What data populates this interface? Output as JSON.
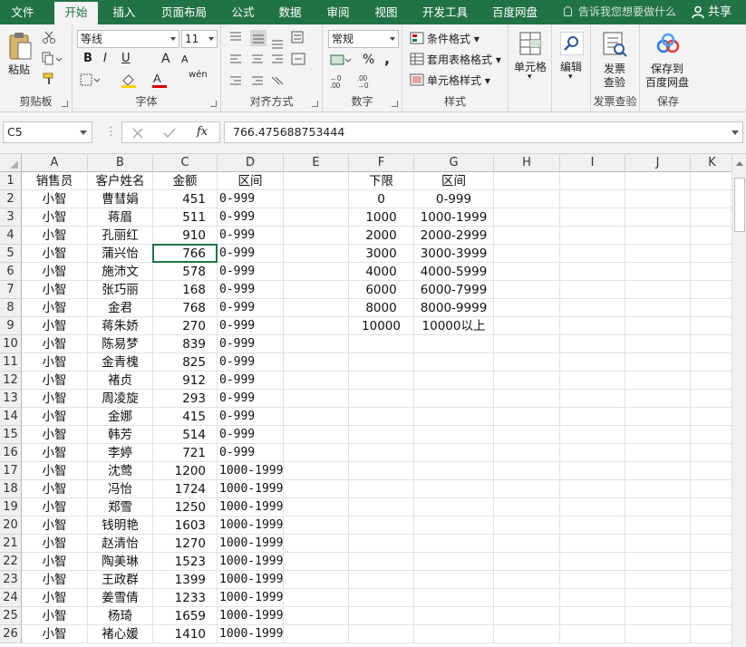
{
  "tabs": [
    "文件",
    "开始",
    "插入",
    "页面布局",
    "公式",
    "数据",
    "审阅",
    "视图",
    "开发工具",
    "百度网盘"
  ],
  "tell_me": "告诉我您想要做什么",
  "share": "共享",
  "ribbon": {
    "clipboard": {
      "paste": "粘贴",
      "label": "剪贴板"
    },
    "font": {
      "name": "等线",
      "size": "11",
      "label": "字体",
      "bold": "B",
      "italic": "I",
      "underline": "U",
      "wen": "wén",
      "grow": "A",
      "shrink": "A"
    },
    "alignment": {
      "label": "对齐方式"
    },
    "number": {
      "format": "常规",
      "label": "数字",
      "percent": "%",
      "comma": ","
    },
    "styles": {
      "conditional": "条件格式",
      "table": "套用表格格式",
      "cell": "单元格样式",
      "label": "样式"
    },
    "cells": {
      "label": "单元格"
    },
    "editing": {
      "label": "编辑"
    },
    "invoice": {
      "button1": "发票",
      "button2": "查验",
      "label": "发票查验"
    },
    "save": {
      "button1": "保存到",
      "button2": "百度网盘",
      "label": "保存"
    }
  },
  "formula_bar": {
    "name_box": "C5",
    "fx": "fx",
    "value": "766.475688753444"
  },
  "columns": [
    "A",
    "B",
    "C",
    "D",
    "E",
    "F",
    "G",
    "H",
    "I",
    "J",
    "K"
  ],
  "header_row": {
    "A": "销售员",
    "B": "客户姓名",
    "C": "金额",
    "D": "区间",
    "F": "下限",
    "G": "区间"
  },
  "rows": [
    [
      "小智",
      "曹彗娟",
      "451",
      "0-999"
    ],
    [
      "小智",
      "蒋眉",
      "511",
      "0-999"
    ],
    [
      "小智",
      "孔丽红",
      "910",
      "0-999"
    ],
    [
      "小智",
      "蒲兴怡",
      "766",
      "0-999"
    ],
    [
      "小智",
      "施沛文",
      "578",
      "0-999"
    ],
    [
      "小智",
      "张巧丽",
      "168",
      "0-999"
    ],
    [
      "小智",
      "金君",
      "768",
      "0-999"
    ],
    [
      "小智",
      "蒋朱娇",
      "270",
      "0-999"
    ],
    [
      "小智",
      "陈易梦",
      "839",
      "0-999"
    ],
    [
      "小智",
      "金青槐",
      "825",
      "0-999"
    ],
    [
      "小智",
      "褚贞",
      "912",
      "0-999"
    ],
    [
      "小智",
      "周凌旋",
      "293",
      "0-999"
    ],
    [
      "小智",
      "金娜",
      "415",
      "0-999"
    ],
    [
      "小智",
      "韩芳",
      "514",
      "0-999"
    ],
    [
      "小智",
      "李婷",
      "721",
      "0-999"
    ],
    [
      "小智",
      "沈莺",
      "1200",
      "1000-1999"
    ],
    [
      "小智",
      "冯怡",
      "1724",
      "1000-1999"
    ],
    [
      "小智",
      "郑雪",
      "1250",
      "1000-1999"
    ],
    [
      "小智",
      "钱明艳",
      "1603",
      "1000-1999"
    ],
    [
      "小智",
      "赵清怡",
      "1270",
      "1000-1999"
    ],
    [
      "小智",
      "陶美琳",
      "1523",
      "1000-1999"
    ],
    [
      "小智",
      "王政群",
      "1399",
      "1000-1999"
    ],
    [
      "小智",
      "姜雪倩",
      "1233",
      "1000-1999"
    ],
    [
      "小智",
      "杨琦",
      "1659",
      "1000-1999"
    ],
    [
      "小智",
      "褚心媛",
      "1410",
      "1000-1999"
    ]
  ],
  "lookup": [
    [
      "0",
      "0-999"
    ],
    [
      "1000",
      "1000-1999"
    ],
    [
      "2000",
      "2000-2999"
    ],
    [
      "3000",
      "3000-3999"
    ],
    [
      "4000",
      "4000-5999"
    ],
    [
      "6000",
      "6000-7999"
    ],
    [
      "8000",
      "8000-9999"
    ],
    [
      "10000",
      "10000以上"
    ]
  ],
  "row_numbers": [
    "1",
    "2",
    "3",
    "4",
    "5",
    "6",
    "7",
    "8",
    "9",
    "10",
    "11",
    "12",
    "13",
    "14",
    "15",
    "16",
    "17",
    "18",
    "19",
    "20",
    "21",
    "22",
    "23",
    "24",
    "25",
    "26"
  ]
}
